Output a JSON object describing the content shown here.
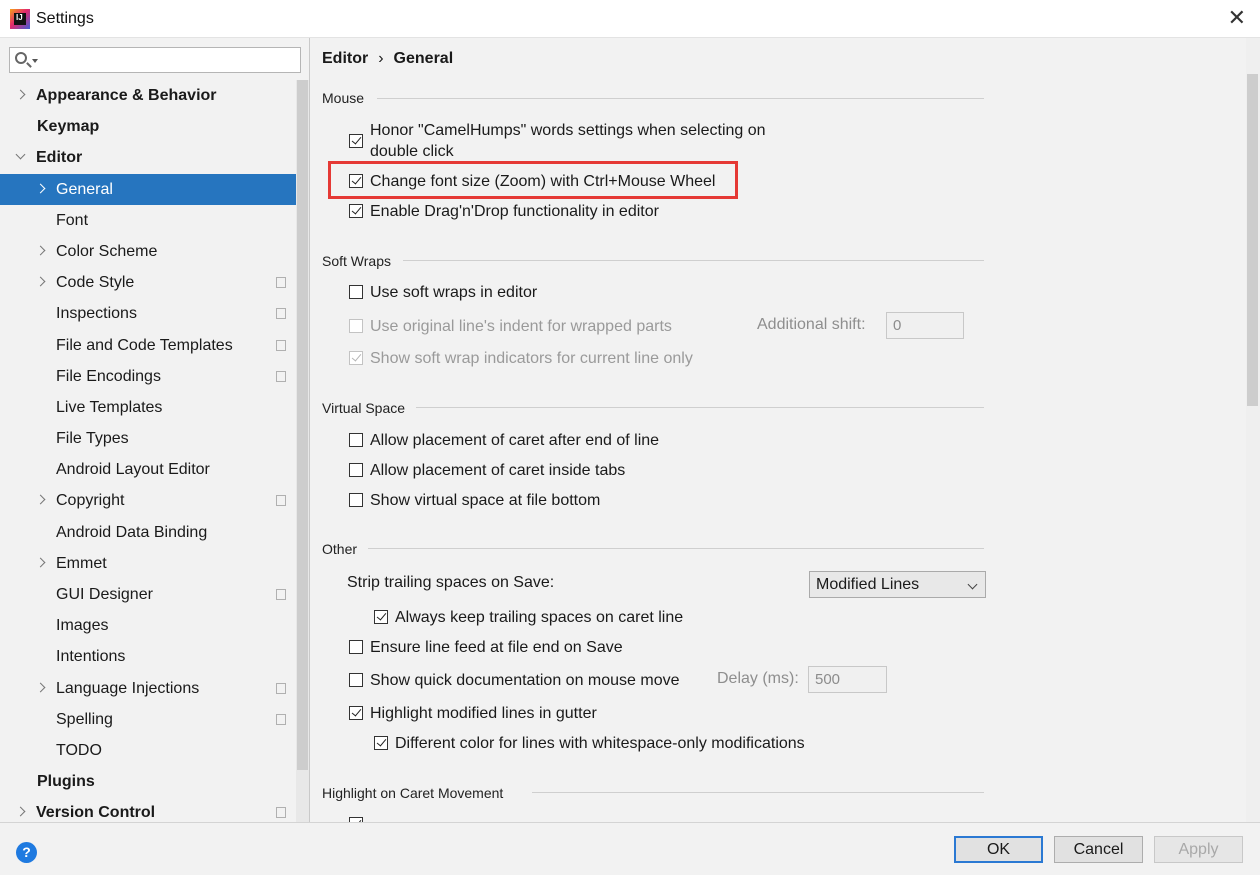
{
  "window": {
    "title": "Settings"
  },
  "search": {
    "placeholder": ""
  },
  "tree": [
    {
      "label": "Appearance & Behavior",
      "level": 0,
      "expander": "right",
      "copy": false
    },
    {
      "label": "Keymap",
      "level": 0,
      "expander": "none",
      "copy": false
    },
    {
      "label": "Editor",
      "level": 0,
      "expander": "down",
      "copy": false
    },
    {
      "label": "General",
      "level": 1,
      "expander": "right",
      "copy": false,
      "selected": true
    },
    {
      "label": "Font",
      "level": 1,
      "expander": "none",
      "copy": false
    },
    {
      "label": "Color Scheme",
      "level": 1,
      "expander": "right",
      "copy": false
    },
    {
      "label": "Code Style",
      "level": 1,
      "expander": "right",
      "copy": true
    },
    {
      "label": "Inspections",
      "level": 1,
      "expander": "none",
      "copy": true
    },
    {
      "label": "File and Code Templates",
      "level": 1,
      "expander": "none",
      "copy": true
    },
    {
      "label": "File Encodings",
      "level": 1,
      "expander": "none",
      "copy": true
    },
    {
      "label": "Live Templates",
      "level": 1,
      "expander": "none",
      "copy": false
    },
    {
      "label": "File Types",
      "level": 1,
      "expander": "none",
      "copy": false
    },
    {
      "label": "Android Layout Editor",
      "level": 1,
      "expander": "none",
      "copy": false
    },
    {
      "label": "Copyright",
      "level": 1,
      "expander": "right",
      "copy": true
    },
    {
      "label": "Android Data Binding",
      "level": 1,
      "expander": "none",
      "copy": false
    },
    {
      "label": "Emmet",
      "level": 1,
      "expander": "right",
      "copy": false
    },
    {
      "label": "GUI Designer",
      "level": 1,
      "expander": "none",
      "copy": true
    },
    {
      "label": "Images",
      "level": 1,
      "expander": "none",
      "copy": false
    },
    {
      "label": "Intentions",
      "level": 1,
      "expander": "none",
      "copy": false
    },
    {
      "label": "Language Injections",
      "level": 1,
      "expander": "right",
      "copy": true
    },
    {
      "label": "Spelling",
      "level": 1,
      "expander": "none",
      "copy": true
    },
    {
      "label": "TODO",
      "level": 1,
      "expander": "none",
      "copy": false
    },
    {
      "label": "Plugins",
      "level": 0,
      "expander": "none",
      "copy": false
    },
    {
      "label": "Version Control",
      "level": 0,
      "expander": "right",
      "copy": true
    }
  ],
  "breadcrumb": {
    "parent": "Editor",
    "separator": "›",
    "current": "General"
  },
  "sections": {
    "mouse": {
      "title": "Mouse",
      "camelhumps": "Honor \"CamelHumps\" words settings when selecting on double click",
      "zoom": "Change font size (Zoom) with Ctrl+Mouse Wheel",
      "dragdrop": "Enable Drag'n'Drop functionality in editor"
    },
    "softwraps": {
      "title": "Soft Wraps",
      "use": "Use soft wraps in editor",
      "indent": "Use original line's indent for wrapped parts",
      "shift_label": "Additional shift:",
      "shift_value": "0",
      "indicators": "Show soft wrap indicators for current line only"
    },
    "virtual": {
      "title": "Virtual Space",
      "after_end": "Allow placement of caret after end of line",
      "inside_tabs": "Allow placement of caret inside tabs",
      "file_bottom": "Show virtual space at file bottom"
    },
    "other": {
      "title": "Other",
      "strip_label": "Strip trailing spaces on Save:",
      "strip_value": "Modified Lines",
      "keep_caret": "Always keep trailing spaces on caret line",
      "line_feed": "Ensure line feed at file end on Save",
      "quick_doc": "Show quick documentation on mouse move",
      "delay_label": "Delay (ms):",
      "delay_value": "500",
      "highlight_gutter": "Highlight modified lines in gutter",
      "whitespace_color": "Different color for lines with whitespace-only modifications"
    },
    "caret": {
      "title": "Highlight on Caret Movement"
    }
  },
  "footer": {
    "help": "?",
    "ok": "OK",
    "cancel": "Cancel",
    "apply": "Apply"
  }
}
